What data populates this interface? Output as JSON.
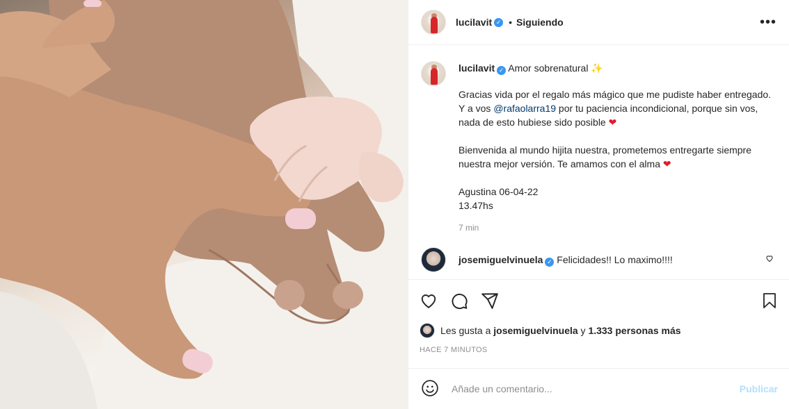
{
  "header": {
    "username": "lucilavit",
    "separator": "•",
    "follow_status": "Siguiendo",
    "more_label": "•••"
  },
  "caption": {
    "username": "lucilavit",
    "title": "Amor sobrenatural",
    "title_emoji": "✨",
    "p1_before": "Gracias vida por el regalo más mágico que me pudiste haber entregado. Y a vos ",
    "p1_mention": "@rafaolarra19",
    "p1_after": " por tu paciencia incondicional, porque sin vos, nada de esto hubiese sido posible ",
    "p1_emoji": "❤",
    "p2": "Bienvenida al mundo hijita nuestra, prometemos entregarte siempre nuestra mejor versión. Te amamos con el alma ",
    "p2_emoji": "❤",
    "p3_line1": "Agustina 06-04-22",
    "p3_line2": "13.47hs",
    "time": "7 min"
  },
  "comment": {
    "username": "josemiguelvinuela",
    "text": "Felicidades!! Lo maximo!!!!"
  },
  "icons": {
    "like": "heart-icon",
    "comment": "comment-icon",
    "share": "share-icon",
    "save": "bookmark-icon",
    "emoji": "emoji-icon"
  },
  "likes": {
    "prefix": "Les gusta a ",
    "user": "josemiguelvinuela",
    "middle": " y ",
    "count": "1.333 personas más"
  },
  "posted": "HACE 7 MINUTOS",
  "add_comment": {
    "placeholder": "Añade un comentario...",
    "publish": "Publicar"
  },
  "colors": {
    "verified": "#3897f0",
    "publish": "#b2dffc",
    "mention": "#00376b"
  }
}
